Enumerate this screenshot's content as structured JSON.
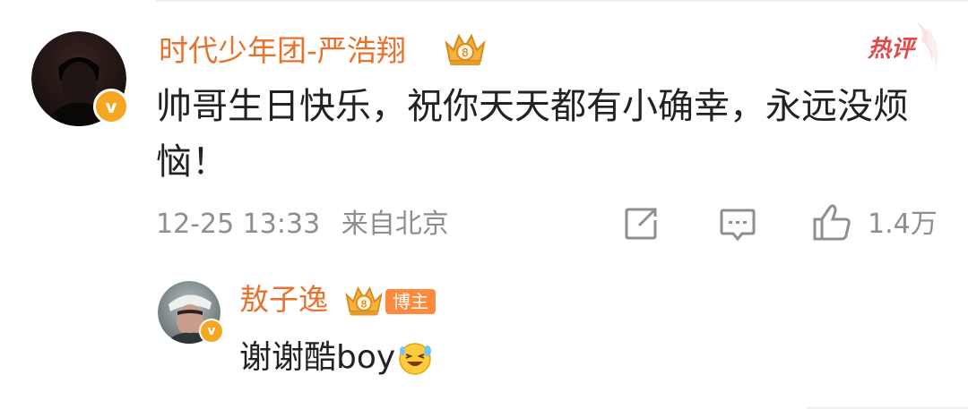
{
  "comment": {
    "username": "时代少年团-严浩翔",
    "badge": "热评",
    "text": "帅哥生日快乐，祝你天天都有小确幸，永远没烦恼！",
    "timestamp": "12-25 13:33",
    "location": "来自北京",
    "like_count": "1.4万",
    "verified_mark": "v"
  },
  "reply": {
    "username": "敖子逸",
    "role_badge": "博主",
    "text": "谢谢酷boy",
    "verified_mark": "v",
    "emoji": "laughing-tears-emoji"
  },
  "colors": {
    "username": "#e8712c",
    "verified": "#f5a623",
    "hot": "#e14a4a",
    "meta": "#8e8e8e",
    "text": "#222222"
  },
  "icons": [
    "crown-badge-icon",
    "share-icon",
    "comment-icon",
    "like-icon",
    "hot-comment-badge"
  ]
}
